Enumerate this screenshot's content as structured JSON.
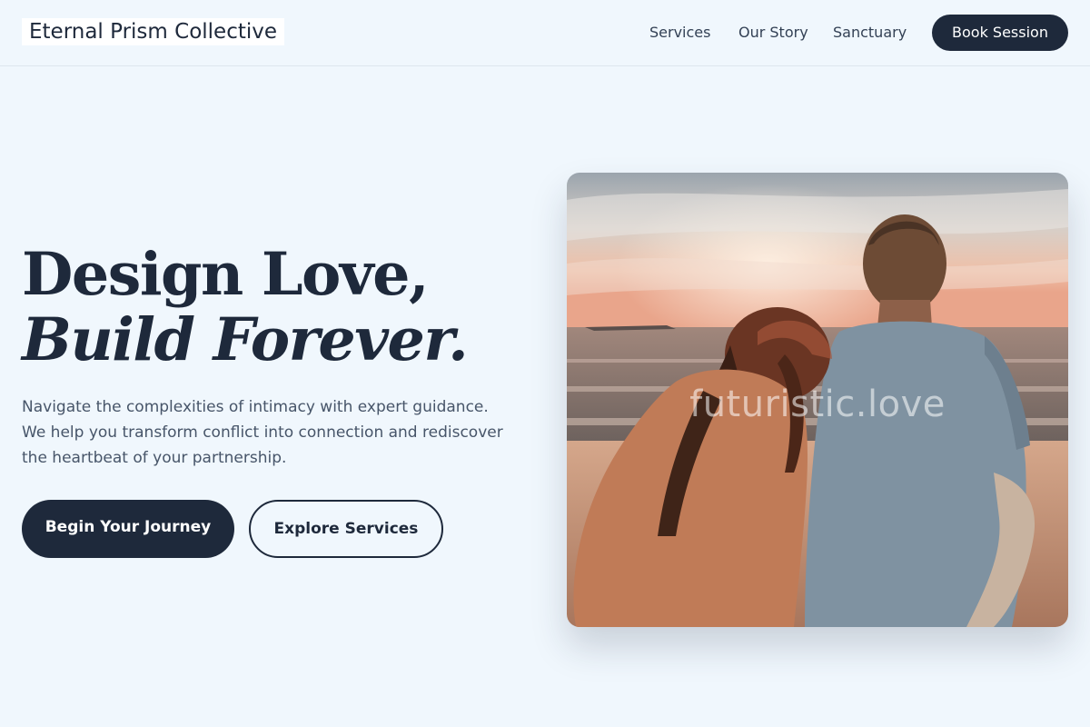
{
  "header": {
    "brand": "Eternal Prism Collective",
    "nav": [
      "Services",
      "Our Story",
      "Sanctuary"
    ],
    "cta": "Book Session"
  },
  "hero": {
    "title_line1": "Design Love,",
    "title_line2": "Build Forever.",
    "description": "Navigate the complexities of intimacy with expert guidance. We help you transform conflict into connection and rediscover the heartbeat of your partnership.",
    "primary_button": "Begin Your Journey",
    "secondary_button": "Explore Services"
  },
  "image": {
    "watermark": "futuristic.love"
  },
  "colors": {
    "background": "#f0f7fd",
    "primary": "#1e293b",
    "text_muted": "#475569"
  }
}
